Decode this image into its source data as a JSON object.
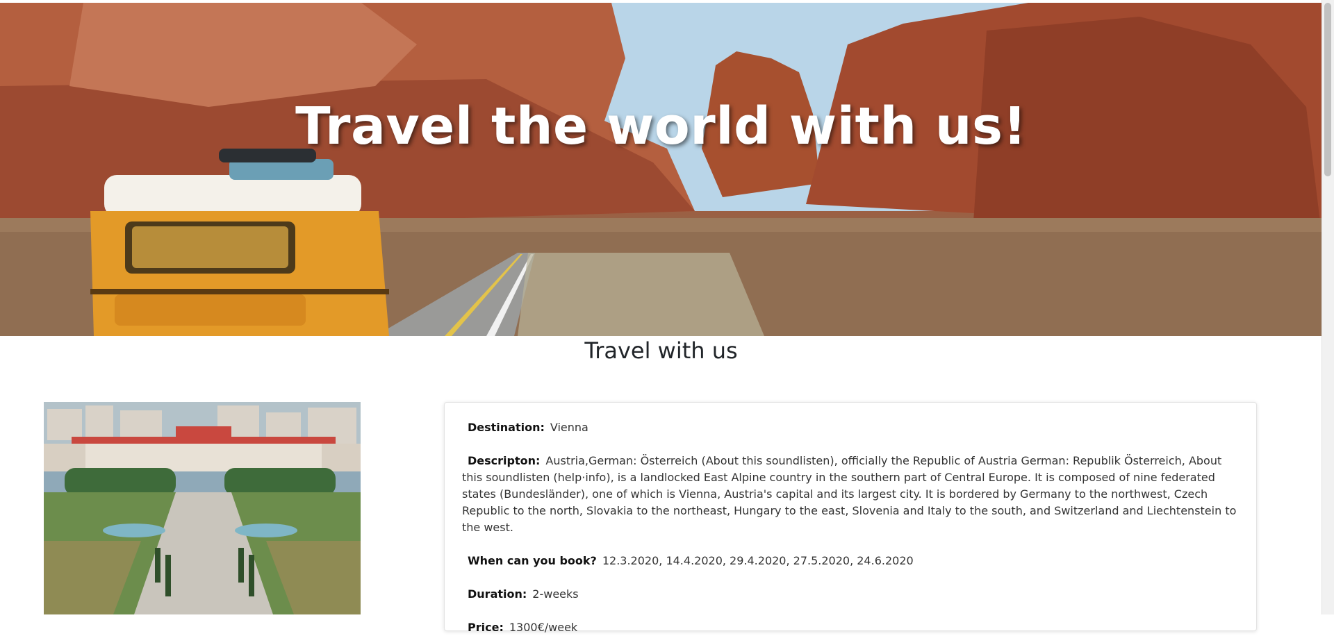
{
  "hero": {
    "title": "Travel the world with us!"
  },
  "section": {
    "title": "Travel with us"
  },
  "trip": {
    "destination_label": "Destination:",
    "destination_value": "Vienna",
    "description_label": "Descripton:",
    "description_value": "Austria,German: Österreich (About this soundlisten), officially the Republic of Austria German: Republik Österreich, About this soundlisten (help·info), is a landlocked East Alpine country in the southern part of Central Europe. It is composed of nine federated states (Bundesländer), one of which is Vienna, Austria's capital and its largest city. It is bordered by Germany to the northwest, Czech Republic to the north, Slovakia to the northeast, Hungary to the east, Slovenia and Italy to the south, and Switzerland and Liechtenstein to the west.",
    "booking_label": "When can you book?",
    "booking_value": "12.3.2020, 14.4.2020, 29.4.2020, 27.5.2020, 24.6.2020",
    "duration_label": "Duration:",
    "duration_value": "2-weeks",
    "price_label": "Price:",
    "price_value": "1300€/week"
  }
}
